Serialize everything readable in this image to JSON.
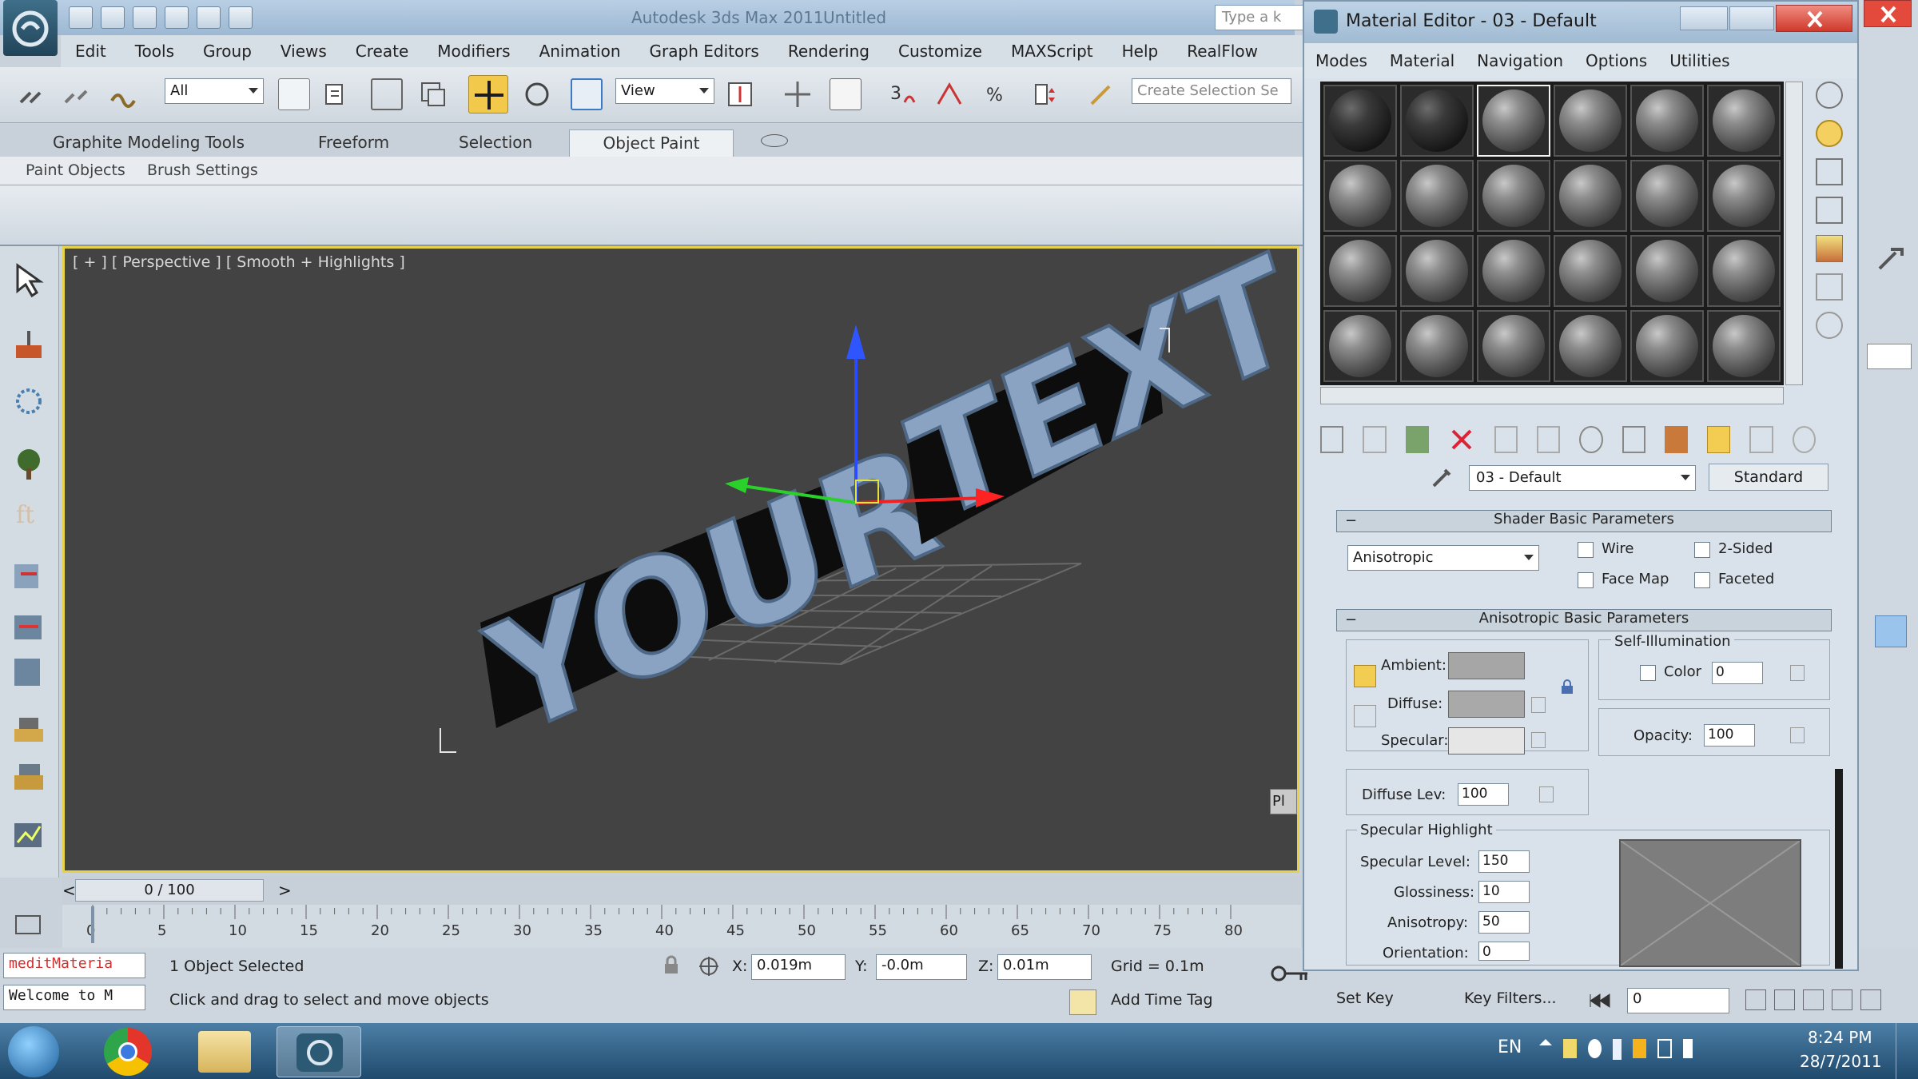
{
  "app": {
    "title": "Autodesk 3ds Max  2011",
    "document": "Untitled",
    "search_placeholder": "Type a k"
  },
  "menu": [
    "Edit",
    "Tools",
    "Group",
    "Views",
    "Create",
    "Modifiers",
    "Animation",
    "Graph Editors",
    "Rendering",
    "Customize",
    "MAXScript",
    "Help",
    "RealFlow"
  ],
  "toolbar": {
    "selection_filter": "All",
    "reference_coord": "View",
    "named_selection": "Create Selection Se"
  },
  "ribbon": {
    "tabs": [
      "Graphite Modeling Tools",
      "Freeform",
      "Selection",
      "Object Paint"
    ],
    "active_tab": "Object Paint",
    "sub_tabs": [
      "Paint Objects",
      "Brush Settings"
    ]
  },
  "viewport": {
    "label": "[ + ] [ Perspective ] [ Smooth + Highlights ]",
    "text_word1": "YOUR",
    "text_word2": "TEXT",
    "side_tab": "Pl"
  },
  "timeline": {
    "frame": "0 / 100",
    "ticks": [
      "0",
      "5",
      "10",
      "15",
      "20",
      "25",
      "30",
      "35",
      "40",
      "45",
      "50",
      "55",
      "60",
      "65",
      "70",
      "75",
      "80"
    ]
  },
  "status": {
    "maxscript_lines": [
      "meditMateria",
      "Welcome to M"
    ],
    "selection": "1 Object Selected",
    "prompt": "Click and drag to select and move objects",
    "x_value": "0.019m",
    "y_value": "-0.0m",
    "z_value": "0.01m",
    "grid": "Grid = 0.1m",
    "add_time_tag": "Add Time Tag",
    "set_key": "Set Key",
    "key_filters": "Key Filters...",
    "frame_field": "0",
    "x_label": "X:",
    "y_label": "Y:",
    "z_label": "Z:"
  },
  "taskbar": {
    "language": "EN",
    "time": "8:24 PM",
    "date": "28/7/2011"
  },
  "material_editor": {
    "title": "Material Editor - 03 - Default",
    "menu": [
      "Modes",
      "Material",
      "Navigation",
      "Options",
      "Utilities"
    ],
    "material_name": "03 - Default",
    "material_type": "Standard",
    "shader_rollout": "Shader Basic Parameters",
    "shader_type": "Anisotropic",
    "options": {
      "wire": "Wire",
      "two_sided": "2-Sided",
      "face_map": "Face Map",
      "faceted": "Faceted"
    },
    "aniso_rollout": "Anisotropic Basic Parameters",
    "self_illum_title": "Self-Illumination",
    "self_illum_color": "Color",
    "self_illum_value": "0",
    "ambient": "Ambient:",
    "diffuse": "Diffuse:",
    "specular": "Specular:",
    "opacity_label": "Opacity:",
    "opacity_value": "100",
    "diffuse_lev_label": "Diffuse Lev:",
    "diffuse_lev_value": "100",
    "specular_highlight_title": "Specular Highlight",
    "spec_level_label": "Specular Level:",
    "spec_level_value": "150",
    "glossiness_label": "Glossiness:",
    "glossiness_value": "10",
    "anisotropy_label": "Anisotropy:",
    "anisotropy_value": "50",
    "orientation_label": "Orientation:",
    "orientation_value": "0",
    "colors": {
      "ambient": "#a6a6a6",
      "diffuse": "#a9a9a9",
      "specular": "#e6e6e6"
    }
  }
}
